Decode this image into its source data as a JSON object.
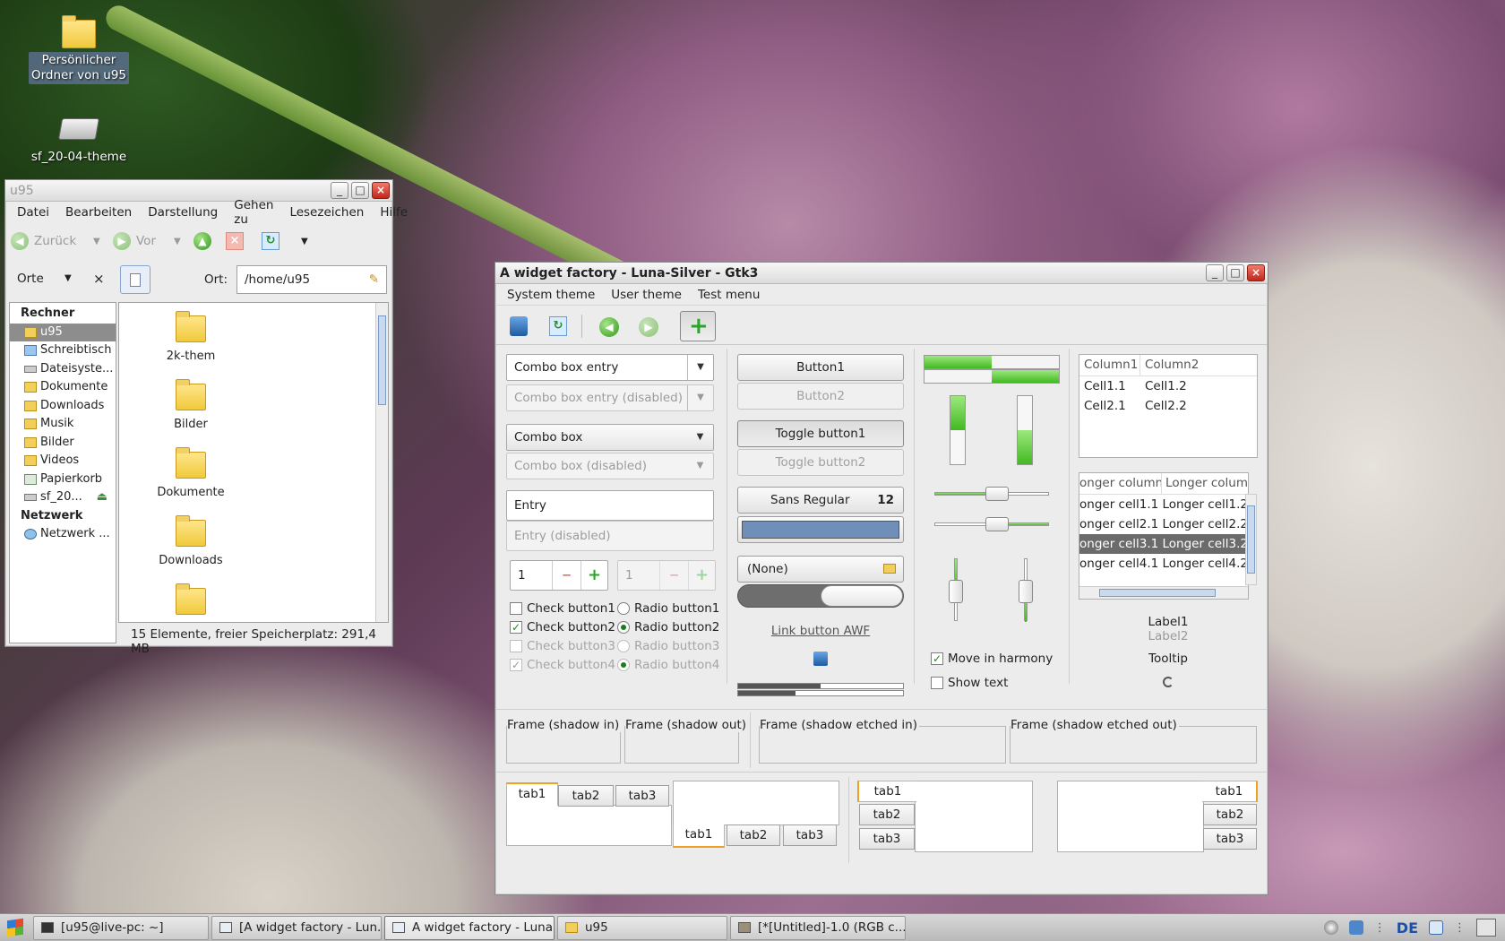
{
  "desktop": {
    "icons": [
      {
        "label_1": "Persönlicher",
        "label_2": "Ordner von u95"
      },
      {
        "label": "sf_20-04-theme"
      }
    ]
  },
  "filemanager": {
    "title": "u95",
    "menu": [
      "Datei",
      "Bearbeiten",
      "Darstellung",
      "Gehen zu",
      "Lesezeichen",
      "Hilfe"
    ],
    "toolbar": {
      "back": "Zurück",
      "forward": "Vor"
    },
    "places_label": "Orte",
    "location_label": "Ort:",
    "location_value": "/home/u95",
    "sidebar": [
      {
        "label": "Rechner",
        "header": true
      },
      {
        "label": "u95",
        "selected": true
      },
      {
        "label": "Schreibtisch"
      },
      {
        "label": "Dateisyste..."
      },
      {
        "label": "Dokumente"
      },
      {
        "label": "Downloads"
      },
      {
        "label": "Musik"
      },
      {
        "label": "Bilder"
      },
      {
        "label": "Videos"
      },
      {
        "label": "Papierkorb"
      },
      {
        "label": "sf_20..."
      },
      {
        "label": "Netzwerk",
        "header": true
      },
      {
        "label": "Netzwerk ..."
      }
    ],
    "files": [
      "2k-them",
      "Bilder",
      "Dokumente",
      "Downloads",
      ""
    ],
    "status": "15 Elemente, freier Speicherplatz: 291,4 MB"
  },
  "factory": {
    "title": "A widget factory - Luna-Silver - Gtk3",
    "menu": [
      "System theme",
      "User theme",
      "Test menu"
    ],
    "combo_entry": "Combo box entry",
    "combo_entry_disabled": "Combo box entry (disabled)",
    "combo": "Combo box",
    "combo_disabled": "Combo box (disabled)",
    "entry": "Entry",
    "entry_disabled": "Entry (disabled)",
    "spin1": "1",
    "spin2": "1",
    "checks": [
      "Check button1",
      "Check button2",
      "Check button3",
      "Check button4"
    ],
    "radios": [
      "Radio button1",
      "Radio button2",
      "Radio button3",
      "Radio button4"
    ],
    "button1": "Button1",
    "button2": "Button2",
    "toggle1": "Toggle button1",
    "toggle2": "Toggle button2",
    "font_name": "Sans Regular",
    "font_size": "12",
    "color_value": "#6f8fba",
    "file_chooser": "(None)",
    "link": "Link button AWF",
    "harmony": "Move in harmony",
    "show_text": "Show text",
    "tree1": {
      "columns": [
        "Column1",
        "Column2"
      ],
      "rows": [
        [
          "Cell1.1",
          "Cell1.2"
        ],
        [
          "Cell2.1",
          "Cell2.2"
        ]
      ]
    },
    "tree2": {
      "columns": [
        "onger column1",
        "Longer colum"
      ],
      "rows": [
        [
          "onger cell1.1",
          "Longer cell1.2"
        ],
        [
          "onger cell2.1",
          "Longer cell2.2"
        ],
        [
          "onger cell3.1",
          "Longer cell3.2"
        ],
        [
          "onger cell4.1",
          "Longer cell4.2"
        ]
      ],
      "selected_row": 2
    },
    "label1": "Label1",
    "label2": "Label2",
    "tooltip": "Tooltip",
    "frames": [
      "Frame (shadow in)",
      "Frame (shadow out)",
      "Frame (shadow etched in)",
      "Frame (shadow etched out)"
    ],
    "tabs": [
      "tab1",
      "tab2",
      "tab3"
    ],
    "progress": {
      "h1": 0.5,
      "h2": 0.5,
      "switch_on": false
    }
  },
  "taskbar": {
    "tasks": [
      "[u95@live-pc: ~]",
      "[A widget factory - Lun...",
      "A widget factory - Luna...",
      "u95",
      "[*[Untitled]-1.0 (RGB c..."
    ],
    "lang": "DE"
  }
}
